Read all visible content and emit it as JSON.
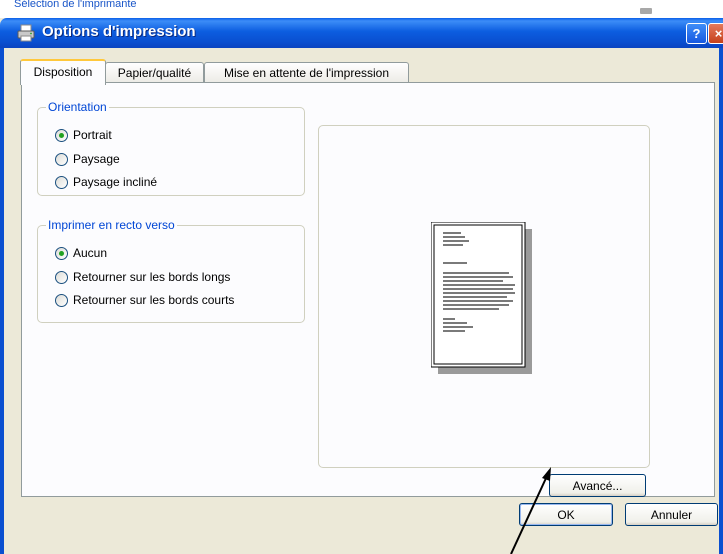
{
  "window": {
    "title": "Options d'impression",
    "behind_text": "Sélection de l'imprimante",
    "help_glyph": "?",
    "close_glyph": "×",
    "icon": "printer-icon"
  },
  "tabs": [
    {
      "label": "Disposition",
      "active": true
    },
    {
      "label": "Papier/qualité",
      "active": false
    },
    {
      "label": "Mise en attente de l'impression",
      "active": false
    }
  ],
  "orientation": {
    "title": "Orientation",
    "options": [
      "Portrait",
      "Paysage",
      "Paysage incliné"
    ],
    "selected": 0
  },
  "duplex": {
    "title": "Imprimer en recto verso",
    "options": [
      "Aucun",
      "Retourner sur les bords longs",
      "Retourner sur les bords courts"
    ],
    "selected": 0
  },
  "buttons": {
    "advanced": "Avancé...",
    "ok": "OK",
    "cancel": "Annuler"
  },
  "colors": {
    "titlebar": "#0a4fd0",
    "group_title": "#0046d5",
    "tab_active_accent": "#ffc83c"
  }
}
